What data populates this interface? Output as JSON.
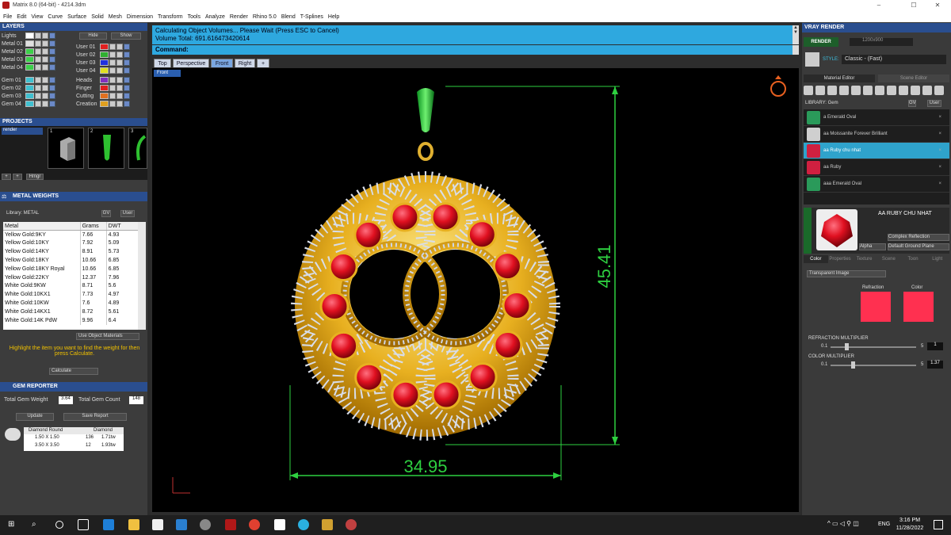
{
  "window": {
    "title": "Matrix 8.0 (64-bit) - 4214.3dm",
    "min": "–",
    "max": "☐",
    "close": "✕"
  },
  "menu": [
    "File",
    "Edit",
    "View",
    "Curve",
    "Surface",
    "Solid",
    "Mesh",
    "Dimension",
    "Transform",
    "Tools",
    "Analyze",
    "Render",
    "Rhino 5.0",
    "Blend",
    "T-Splines",
    "Help"
  ],
  "layers": {
    "title": "LAYERS",
    "hide": "Hide",
    "show": "Show",
    "left": [
      {
        "name": "Lights",
        "color": "#ffffff"
      },
      {
        "name": "Metal 01",
        "color": "#e0e0e0"
      },
      {
        "name": "Metal 02",
        "color": "#3cd04a"
      },
      {
        "name": "Metal 03",
        "color": "#3cd04a"
      },
      {
        "name": "Metal 04",
        "color": "#3cd04a"
      }
    ],
    "right": [
      {
        "name": "User 01",
        "color": "#e02020"
      },
      {
        "name": "User 02",
        "color": "#30b030"
      },
      {
        "name": "User 03",
        "color": "#2030e0"
      },
      {
        "name": "User 04",
        "color": "#e0e020"
      }
    ],
    "gems": [
      {
        "name": "Gem 01",
        "color": "#40c0d0"
      },
      {
        "name": "Gem 02",
        "color": "#40c0d0"
      },
      {
        "name": "Gem 03",
        "color": "#40c0d0"
      },
      {
        "name": "Gem 04",
        "color": "#40c0d0"
      }
    ],
    "misc": [
      {
        "name": "Heads",
        "color": "#8030c0"
      },
      {
        "name": "Finger",
        "color": "#e02020"
      },
      {
        "name": "Cutting",
        "color": "#e07020"
      },
      {
        "name": "Creation",
        "color": "#e0a020"
      }
    ]
  },
  "projects": {
    "title": "PROJECTS",
    "item": "render",
    "thumbs": [
      "1",
      "2",
      "3"
    ],
    "hmgr": "Hmgr"
  },
  "metal_weights": {
    "title": "METAL WEIGHTS",
    "library": "Library: METAL",
    "gv": "GV",
    "user": "User",
    "headers": [
      "Metal",
      "Grams",
      "DWT"
    ],
    "rows": [
      [
        "Yellow Gold:9KY",
        "7.66",
        "4.93"
      ],
      [
        "Yellow Gold:10KY",
        "7.92",
        "5.09"
      ],
      [
        "Yellow Gold:14KY",
        "8.91",
        "5.73"
      ],
      [
        "Yellow Gold:18KY",
        "10.66",
        "6.85"
      ],
      [
        "Yellow Gold:18KY Royal",
        "10.66",
        "6.85"
      ],
      [
        "Yellow Gold:22KY",
        "12.37",
        "7.96"
      ],
      [
        "White Gold:9KW",
        "8.71",
        "5.6"
      ],
      [
        "White Gold:10KX1",
        "7.73",
        "4.97"
      ],
      [
        "White Gold:10KW",
        "7.6",
        "4.89"
      ],
      [
        "White Gold:14KX1",
        "8.72",
        "5.61"
      ],
      [
        "White Gold:14K PdW",
        "9.96",
        "6.4"
      ]
    ],
    "use_object": "Use Object Materials",
    "hint": "Highlight the item you want to find the weight for then press Calculate.",
    "calculate": "Calculate"
  },
  "gem_reporter": {
    "title": "GEM REPORTER",
    "total_weight_label": "Total Gem Weight",
    "total_weight": "3.64",
    "total_count_label": "Total Gem Count",
    "total_count": "148",
    "update": "Update",
    "save": "Save Report",
    "headers": [
      "Diamond Round",
      "Diamond"
    ],
    "rows": [
      [
        "1.50 X 1.50",
        "136",
        "1.71tw"
      ],
      [
        "3.50 X 3.50",
        "12",
        "1.93tw"
      ]
    ]
  },
  "command": {
    "line1": "Calculating Object Volumes... Please Wait (Press ESC to Cancel)",
    "line2": "Volume Total: 691.616473420614",
    "prompt": "Command:"
  },
  "viewtabs": [
    "Top",
    "Perspective",
    "Front",
    "Right",
    "+"
  ],
  "viewport": {
    "label": "Front",
    "dim_h": "45.41",
    "dim_w": "34.95"
  },
  "vray": {
    "title": "VRAY RENDER",
    "render": "RENDER",
    "size": "1200x900",
    "style_label": "STYLE:",
    "style": "Classic - (Fast)",
    "tabs": [
      "Material Editor",
      "Scene Editor"
    ],
    "library": "LIBRARY: Gem",
    "gv": "GV",
    "user": "User",
    "materials": [
      {
        "name": "a Emerald Oval",
        "color": "#2a9a5a"
      },
      {
        "name": "aa Moissanite Forever Brilliant",
        "color": "#cfcfcf"
      },
      {
        "name": "aa Ruby chu nhat",
        "color": "#d02040"
      },
      {
        "name": "aa Ruby",
        "color": "#d02040"
      },
      {
        "name": "aaa Emerald Oval",
        "color": "#2a9a5a"
      }
    ],
    "preview_name": "AA RUBY CHU NHAT",
    "complex": "Complex Reflection",
    "alpha": "Alpha",
    "ground": "Default Ground Plane",
    "ptabs": [
      "Color",
      "Properties",
      "Texture",
      "Scene",
      "Toon",
      "Light"
    ],
    "transparent": "Transparent Image",
    "refraction": "Refraction",
    "color": "Color",
    "refr_mult": "REFRACTION MULTIPLIER",
    "refr_min": "0.1",
    "refr_max": "5",
    "refr_val": "1",
    "col_mult": "COLOR MULTIPLIER",
    "col_min": "0.1",
    "col_max": "5",
    "col_val": "1.37"
  },
  "taskbar": {
    "time": "3:16 PM",
    "date": "11/28/2022",
    "lang": "ENG"
  }
}
